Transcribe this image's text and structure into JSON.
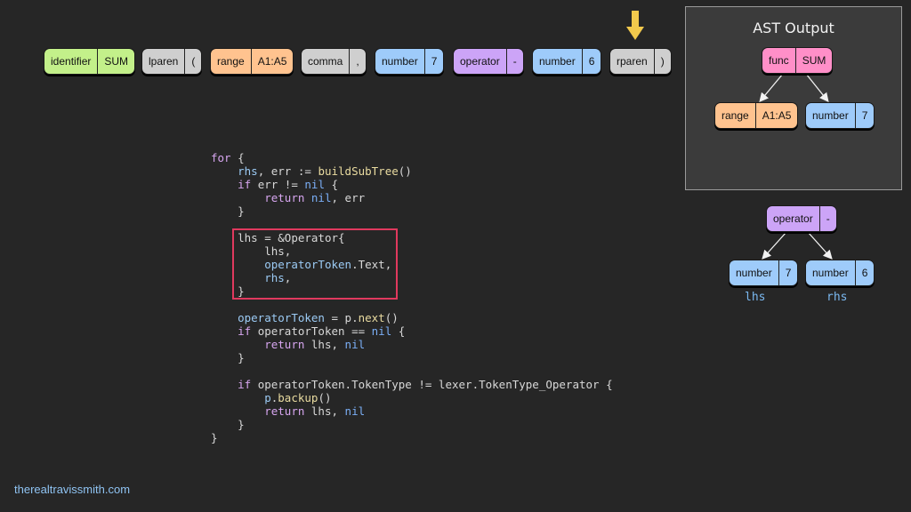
{
  "token_stream": [
    {
      "type": "identifier",
      "value": "SUM",
      "color": "#c3f08a"
    },
    {
      "type": "lparen",
      "value": "(",
      "color": "#cfcfcf"
    },
    {
      "type": "range",
      "value": "A1:A5",
      "color": "#ffc38f"
    },
    {
      "type": "comma",
      "value": ",",
      "color": "#cfcfcf"
    },
    {
      "type": "number",
      "value": "7",
      "color": "#9ecbfa"
    },
    {
      "type": "operator",
      "value": "-",
      "color": "#cca4f7"
    },
    {
      "type": "number",
      "value": "6",
      "color": "#9ecbfa"
    },
    {
      "type": "rparen",
      "value": ")",
      "color": "#cfcfcf"
    }
  ],
  "current_token_marker": "down-arrow-icon",
  "ast_panel": {
    "title": "AST Output",
    "root": {
      "type": "func",
      "value": "SUM"
    },
    "children": [
      {
        "type": "range",
        "value": "A1:A5"
      },
      {
        "type": "number",
        "value": "7"
      }
    ]
  },
  "subtree": {
    "root": {
      "type": "operator",
      "value": "-"
    },
    "left": {
      "type": "number",
      "value": "7",
      "label": "lhs"
    },
    "right": {
      "type": "number",
      "value": "6",
      "label": "rhs"
    }
  },
  "code_lines": [
    "for {",
    "    rhs, err := buildSubTree()",
    "    if err != nil {",
    "        return nil, err",
    "    }",
    "",
    "    lhs = &Operator{",
    "        lhs,",
    "        operatorToken.Text,",
    "        rhs,",
    "    }",
    "",
    "    operatorToken = p.next()",
    "    if operatorToken == nil {",
    "        return lhs, nil",
    "    }",
    "",
    "    if operatorToken.TokenType != lexer.TokenType_Operator {",
    "        p.backup()",
    "        return lhs, nil",
    "    }",
    "}"
  ],
  "footer": "therealtravissmith.com",
  "colors": {
    "background": "#262626",
    "highlight": "#e0395e",
    "arrow": "#f2c94c"
  }
}
